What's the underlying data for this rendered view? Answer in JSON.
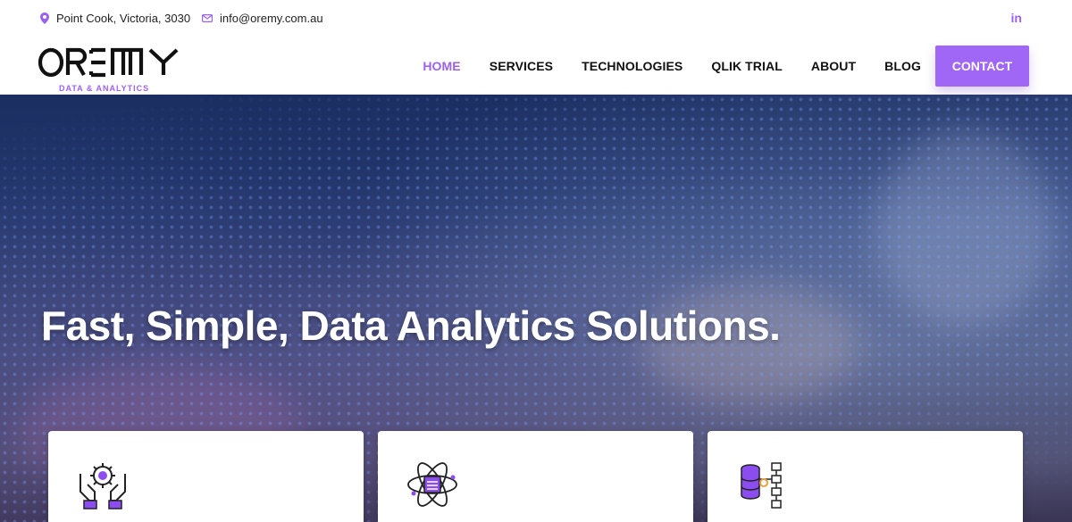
{
  "topbar": {
    "address": "Point Cook, Victoria, 3030",
    "email": "info@oremy.com.au",
    "social": "in"
  },
  "brand": {
    "name": "OREMY",
    "tagline": "DATA & ANALYTICS",
    "accent_color": "#9b62f0"
  },
  "nav": {
    "items": [
      {
        "label": "HOME",
        "active": true
      },
      {
        "label": "SERVICES"
      },
      {
        "label": "TECHNOLOGIES"
      },
      {
        "label": "QLIK TRIAL"
      },
      {
        "label": "ABOUT"
      },
      {
        "label": "BLOG"
      }
    ],
    "cta": "CONTACT"
  },
  "hero": {
    "title": "Fast, Simple, Data Analytics Solutions."
  },
  "cards": [
    {
      "icon": "hands-gear-icon"
    },
    {
      "icon": "atom-server-icon"
    },
    {
      "icon": "database-flow-icon"
    }
  ]
}
